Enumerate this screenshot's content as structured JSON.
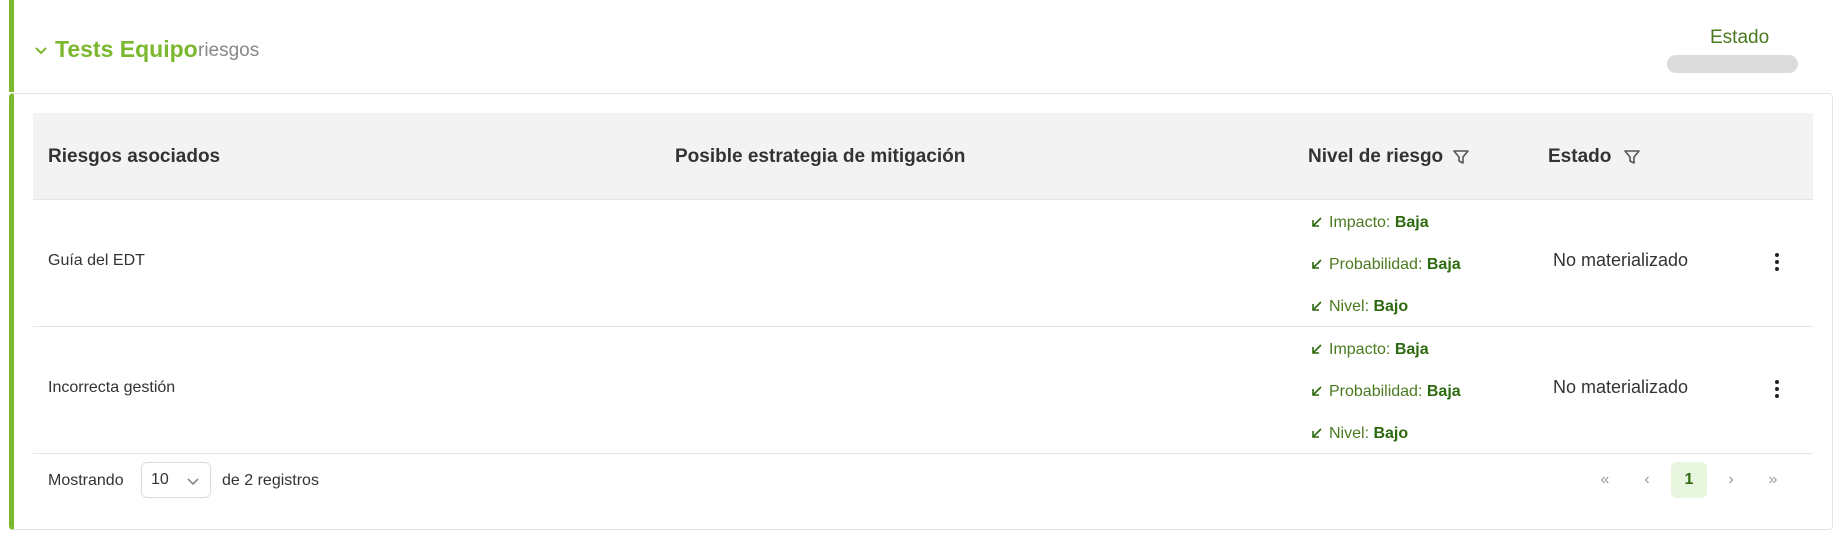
{
  "section": {
    "title": "Tests Equipo",
    "subtitle": "riesgos",
    "status_label": "Estado",
    "accent_color": "#7cb82f"
  },
  "table": {
    "headers": {
      "risks": "Riesgos asociados",
      "mitigation": "Posible estrategia de mitigación",
      "level": "Nivel de riesgo",
      "status": "Estado"
    },
    "rows": [
      {
        "name": "Guía del EDT",
        "mitigation": "",
        "impact_label": "Impacto:",
        "impact": "Baja",
        "probability_label": "Probabilidad:",
        "probability": "Baja",
        "level_label": "Nivel:",
        "level": "Bajo",
        "status": "No materializado"
      },
      {
        "name": "Incorrecta gestión",
        "mitigation": "",
        "impact_label": "Impacto:",
        "impact": "Baja",
        "probability_label": "Probabilidad:",
        "probability": "Baja",
        "level_label": "Nivel:",
        "level": "Bajo",
        "status": "No materializado"
      }
    ]
  },
  "pagination": {
    "showing_label": "Mostrando",
    "page_size": "10",
    "total_label": "de 2 registros",
    "first": "«",
    "prev": "‹",
    "current_page": "1",
    "next": "›",
    "last": "»"
  },
  "icons": {
    "chevron": "chevron-down-icon",
    "filter": "filter-icon",
    "arrow": "arrow-down-left-icon",
    "menu": "more-vertical-icon"
  }
}
